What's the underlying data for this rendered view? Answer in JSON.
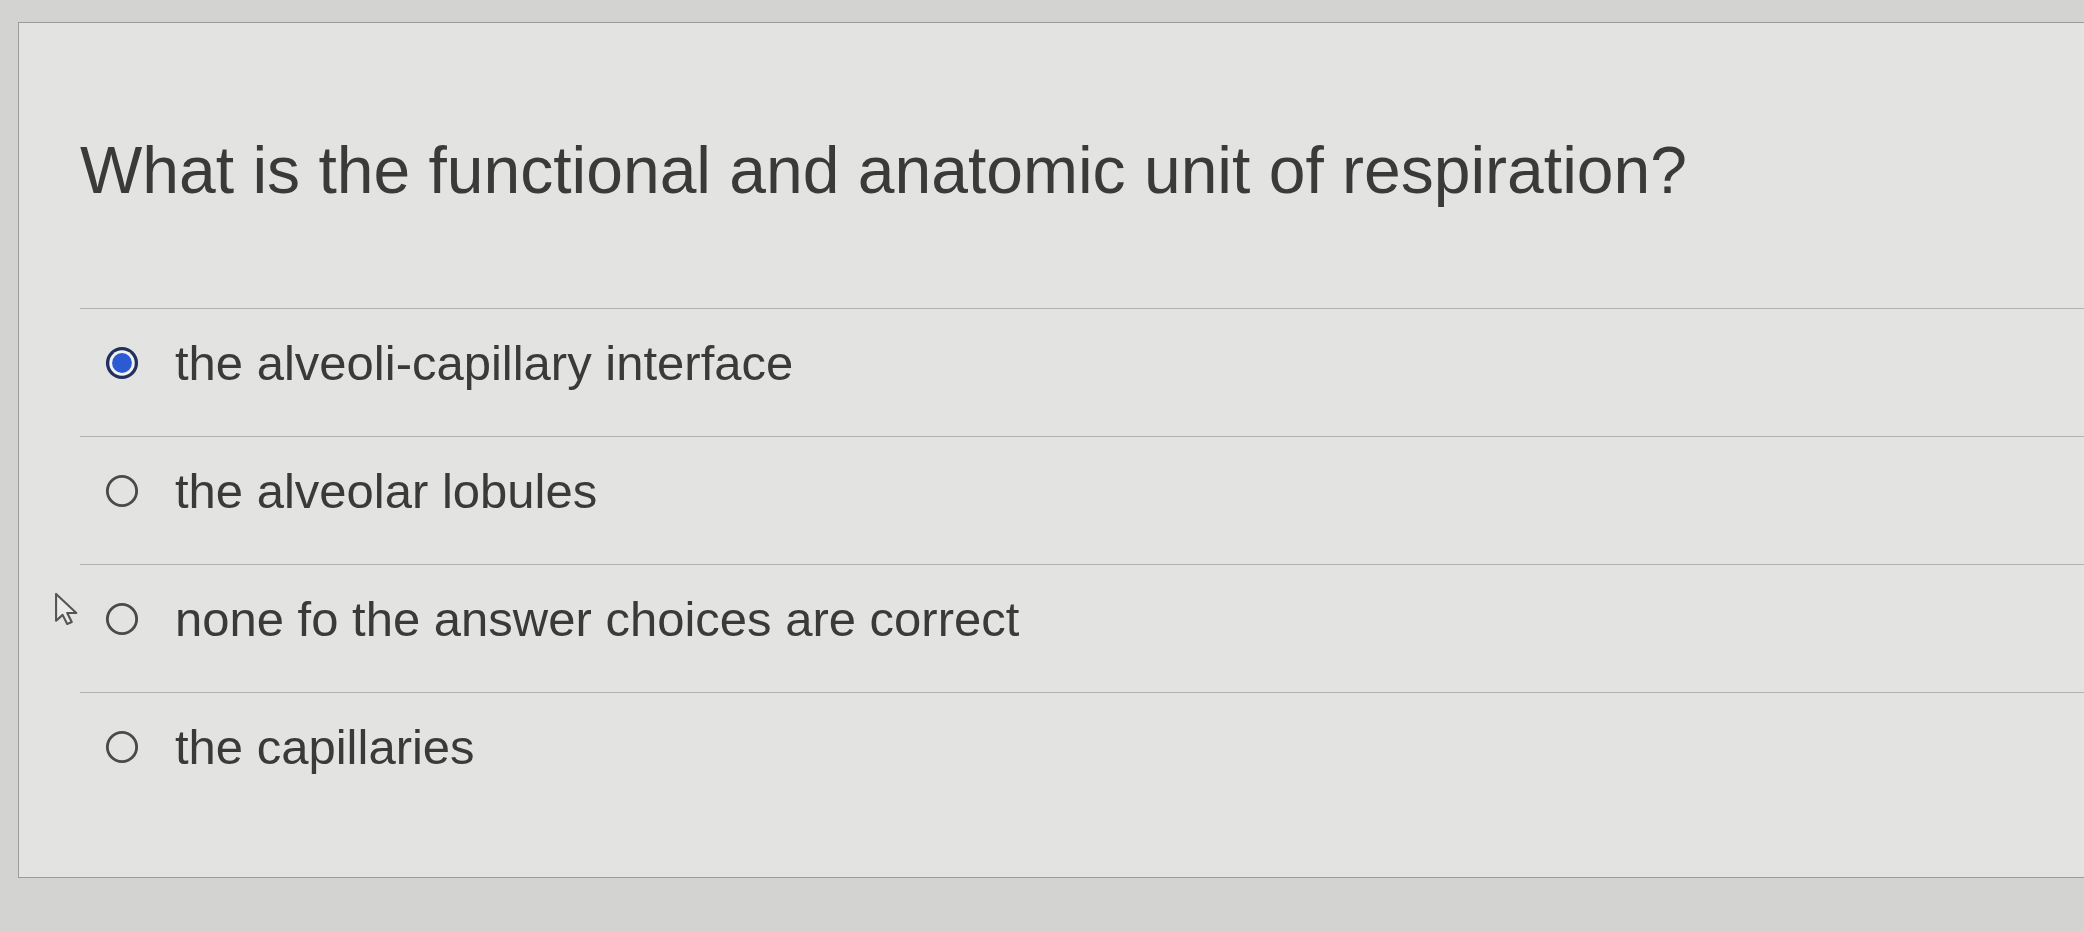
{
  "question": {
    "text": "What is the functional and anatomic unit of respiration?"
  },
  "options": [
    {
      "label": "the alveoli-capillary interface",
      "selected": true
    },
    {
      "label": "the alveolar lobules",
      "selected": false
    },
    {
      "label": "none fo the answer choices are correct",
      "selected": false
    },
    {
      "label": "the capillaries",
      "selected": false
    }
  ]
}
